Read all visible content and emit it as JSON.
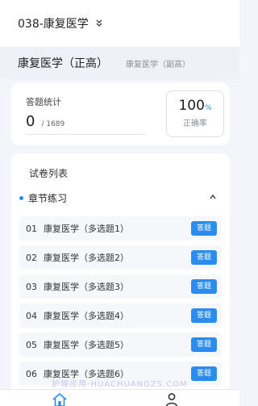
{
  "header": {
    "course_title": "038-康复医学",
    "dropdown_icon": "chevron-double-down-icon"
  },
  "roles": {
    "main": "康复医学（正高）",
    "sub": "康复医学（副高）"
  },
  "stats": {
    "label": "答题统计",
    "answered": "0",
    "total": "/ 1689",
    "rate_value": "100",
    "rate_unit": "%",
    "rate_label": "正确率"
  },
  "paper_list": {
    "heading": "试卷列表",
    "section": {
      "label": "章节练习",
      "expanded_icon": "chevron-up-icon"
    },
    "items": [
      {
        "num": "01",
        "label": "康复医学（多选题1）",
        "button": "答题"
      },
      {
        "num": "02",
        "label": "康复医学（多选题2）",
        "button": "答题"
      },
      {
        "num": "03",
        "label": "康复医学（多选题3）",
        "button": "答题"
      },
      {
        "num": "04",
        "label": "康复医学（多选题4）",
        "button": "答题"
      },
      {
        "num": "05",
        "label": "康复医学（多选题5）",
        "button": "答题"
      },
      {
        "num": "06",
        "label": "康复医学（多选题6）",
        "button": "答题"
      }
    ]
  },
  "watermark": "护理应用·HUACHUANGZS.COM",
  "bottom_nav": {
    "home_icon": "home-icon",
    "user_icon": "user-icon"
  },
  "colors": {
    "accent": "#2b8cf0",
    "background": "#f3f5fa",
    "card": "#ffffff"
  }
}
